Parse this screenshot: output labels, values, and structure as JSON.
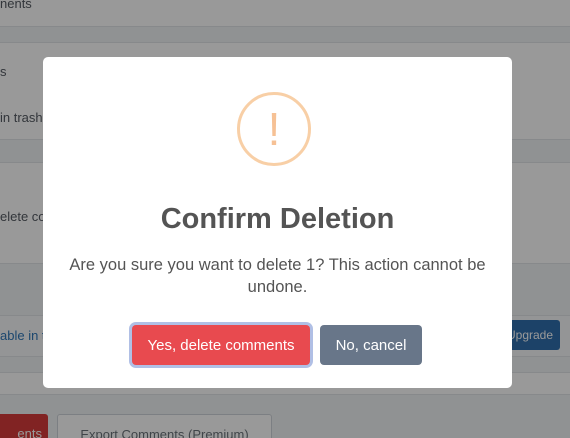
{
  "background": {
    "card1_text": "nents",
    "card2_text_top": "s",
    "card2_text": "in trash",
    "card3_text": "elete co",
    "card4_link": "able in t",
    "upgrade_label": "Upgrade",
    "delete_button_label": "ents",
    "export_button_label": "Export Comments (Premium)"
  },
  "modal": {
    "icon_glyph": "!",
    "icon": "exclamation-icon",
    "title": "Confirm Deletion",
    "message": "Are you sure you want to delete 1? This action cannot be undone.",
    "confirm_label": "Yes, delete comments",
    "cancel_label": "No, cancel"
  },
  "colors": {
    "confirm": "#e84a4f",
    "cancel": "#687689",
    "warning": "#f8cfa6",
    "upgrade": "#2f6fad"
  }
}
